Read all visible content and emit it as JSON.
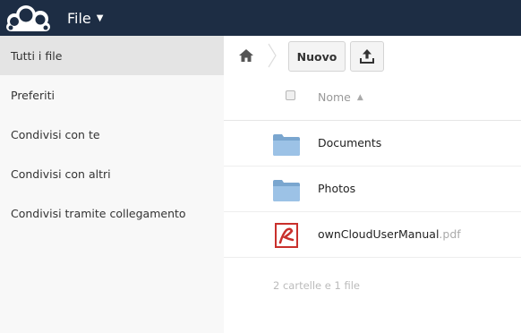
{
  "header": {
    "app_title": "File",
    "caret": "▼",
    "logo_icon": "owncloud-logo-icon",
    "background": "#1d2d44"
  },
  "sidebar": {
    "items": [
      {
        "label": "Tutti i file",
        "active": true
      },
      {
        "label": "Preferiti",
        "active": false
      },
      {
        "label": "Condivisi con te",
        "active": false
      },
      {
        "label": "Condivisi con altri",
        "active": false
      },
      {
        "label": "Condivisi tramite collegamento",
        "active": false
      }
    ]
  },
  "controls": {
    "home_icon": "home-icon",
    "new_label": "Nuovo",
    "upload_icon": "upload-icon"
  },
  "table": {
    "name_header": "Nome",
    "sort_indicator": "▲",
    "rows": [
      {
        "name": "Documents",
        "ext": "",
        "icon": "folder-icon"
      },
      {
        "name": "Photos",
        "ext": "",
        "icon": "folder-icon"
      },
      {
        "name": "ownCloudUserManual",
        "ext": ".pdf",
        "icon": "pdf-icon"
      }
    ]
  },
  "summary": "2 cartelle e 1 file"
}
